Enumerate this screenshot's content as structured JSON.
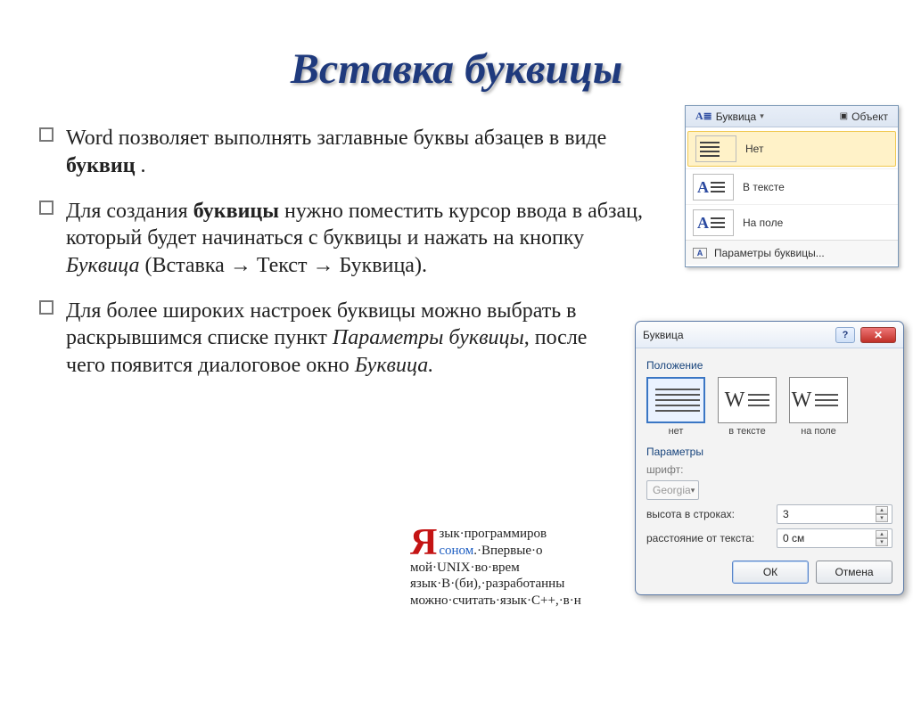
{
  "title": "Вставка буквицы",
  "para1_a": "Word позволяет выполнять заглавные буквы абзацев в виде ",
  "para1_b": "буквиц",
  "para1_c": " .",
  "para2_a": "Для создания ",
  "para2_b": "буквицы",
  "para2_c": " нужно поместить курсор ввода в абзац, который будет начинаться с буквицы и нажать на кнопку ",
  "para2_d": "Буквица",
  "para2_e": " (Вставка ",
  "arrow": "→",
  "para2_f": " Текст ",
  "para2_g": " Буквица).",
  "para3_a": "Для более широких настроек буквицы можно выбрать в раскрывшимся списке пункт ",
  "para3_b": "Параметры буквицы",
  "para3_c": ", после чего появится диалоговое окно ",
  "para3_d": "Буквица.",
  "ribbon": {
    "button": "Буквица",
    "object": "Объект",
    "items": [
      {
        "label": "Нет"
      },
      {
        "label": "В тексте"
      },
      {
        "label": "На поле"
      }
    ],
    "params": "Параметры буквицы..."
  },
  "dialog": {
    "title": "Буквица",
    "section_position": "Положение",
    "positions": [
      {
        "label": "нет"
      },
      {
        "label": "в тексте"
      },
      {
        "label": "на поле"
      }
    ],
    "section_params": "Параметры",
    "font_label": "шрифт:",
    "font_value": "Georgia",
    "height_label": "высота в строках:",
    "height_value": "3",
    "distance_label": "расстояние от текста:",
    "distance_value": "0 см",
    "ok": "ОК",
    "cancel": "Отмена",
    "help": "?",
    "close": "✕"
  },
  "sample": {
    "dropcap": "Я",
    "line1a": "зык·программиров",
    "line1b": "соном",
    "line1c": ".·Впервые·о",
    "line2": "мой·UNIX·во·врем",
    "line3": "язык·B·(би),·разработанны",
    "line4": "можно·считать·язык·C++,·в·н"
  }
}
